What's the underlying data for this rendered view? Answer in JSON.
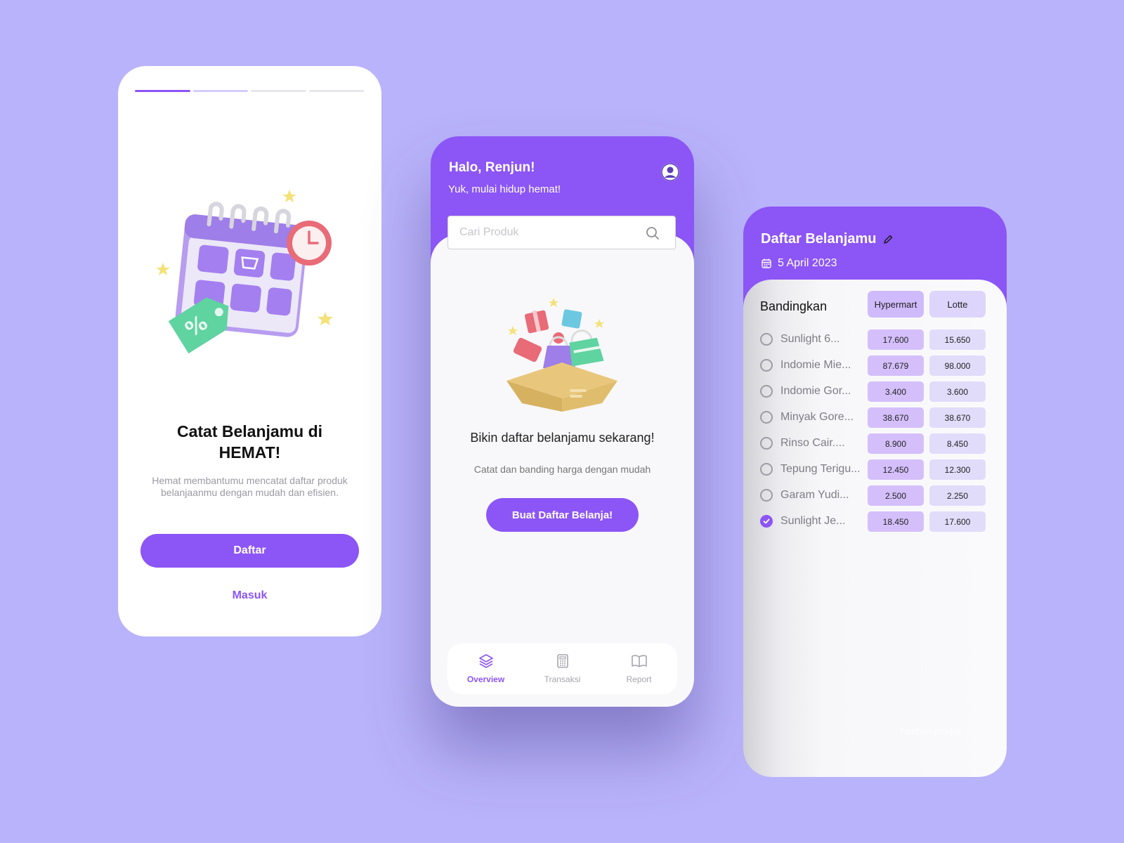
{
  "screen1": {
    "progress_steps": 4,
    "progress_active": 1,
    "title": "Catat Belanjamu di HEMAT!",
    "description": "Hemat membantumu mencatat daftar produk belanjaanmu dengan mudah dan efisien.",
    "register_label": "Daftar",
    "login_label": "Masuk"
  },
  "screen2": {
    "greeting": "Halo, Renjun!",
    "subtitle": "Yuk, mulai hidup hemat!",
    "search_placeholder": "Cari Produk",
    "empty_title": "Bikin daftar belanjamu sekarang!",
    "empty_desc": "Catat dan banding harga dengan mudah",
    "create_button": "Buat Daftar Belanja!",
    "tabs": [
      {
        "label": "Overview",
        "icon": "layers-icon",
        "active": true
      },
      {
        "label": "Transaksi",
        "icon": "calculator-icon",
        "active": false
      },
      {
        "label": "Report",
        "icon": "book-open-icon",
        "active": false
      }
    ]
  },
  "screen3": {
    "title": "Daftar Belanjamu",
    "date": "5 April 2023",
    "compare_label": "Bandingkan",
    "stores": [
      "Hypermart",
      "Lotte"
    ],
    "items": [
      {
        "name": "Sunlight 6...",
        "prices": [
          "17.600",
          "15.650"
        ],
        "checked": false
      },
      {
        "name": "Indomie Mie...",
        "prices": [
          "87.679",
          "98.000"
        ],
        "checked": false
      },
      {
        "name": "Indomie Gor...",
        "prices": [
          "3.400",
          "3.600"
        ],
        "checked": false
      },
      {
        "name": "Minyak Gore...",
        "prices": [
          "38.670",
          "38.670"
        ],
        "checked": false
      },
      {
        "name": "Rinso Cair....",
        "prices": [
          "8.900",
          "8.450"
        ],
        "checked": false
      },
      {
        "name": "Tepung Terigu...",
        "prices": [
          "12.450",
          "12.300"
        ],
        "checked": false
      },
      {
        "name": "Garam Yudi...",
        "prices": [
          "2.500",
          "2.250"
        ],
        "checked": false
      },
      {
        "name": "Sunlight Je...",
        "prices": [
          "18.450",
          "17.600"
        ],
        "checked": true
      }
    ],
    "add_label": "Tambah produk"
  },
  "colors": {
    "accent": "#8c55f6",
    "background": "#b9b3fb",
    "price_a": "#d4bffb",
    "price_b": "#e2dcfb"
  }
}
